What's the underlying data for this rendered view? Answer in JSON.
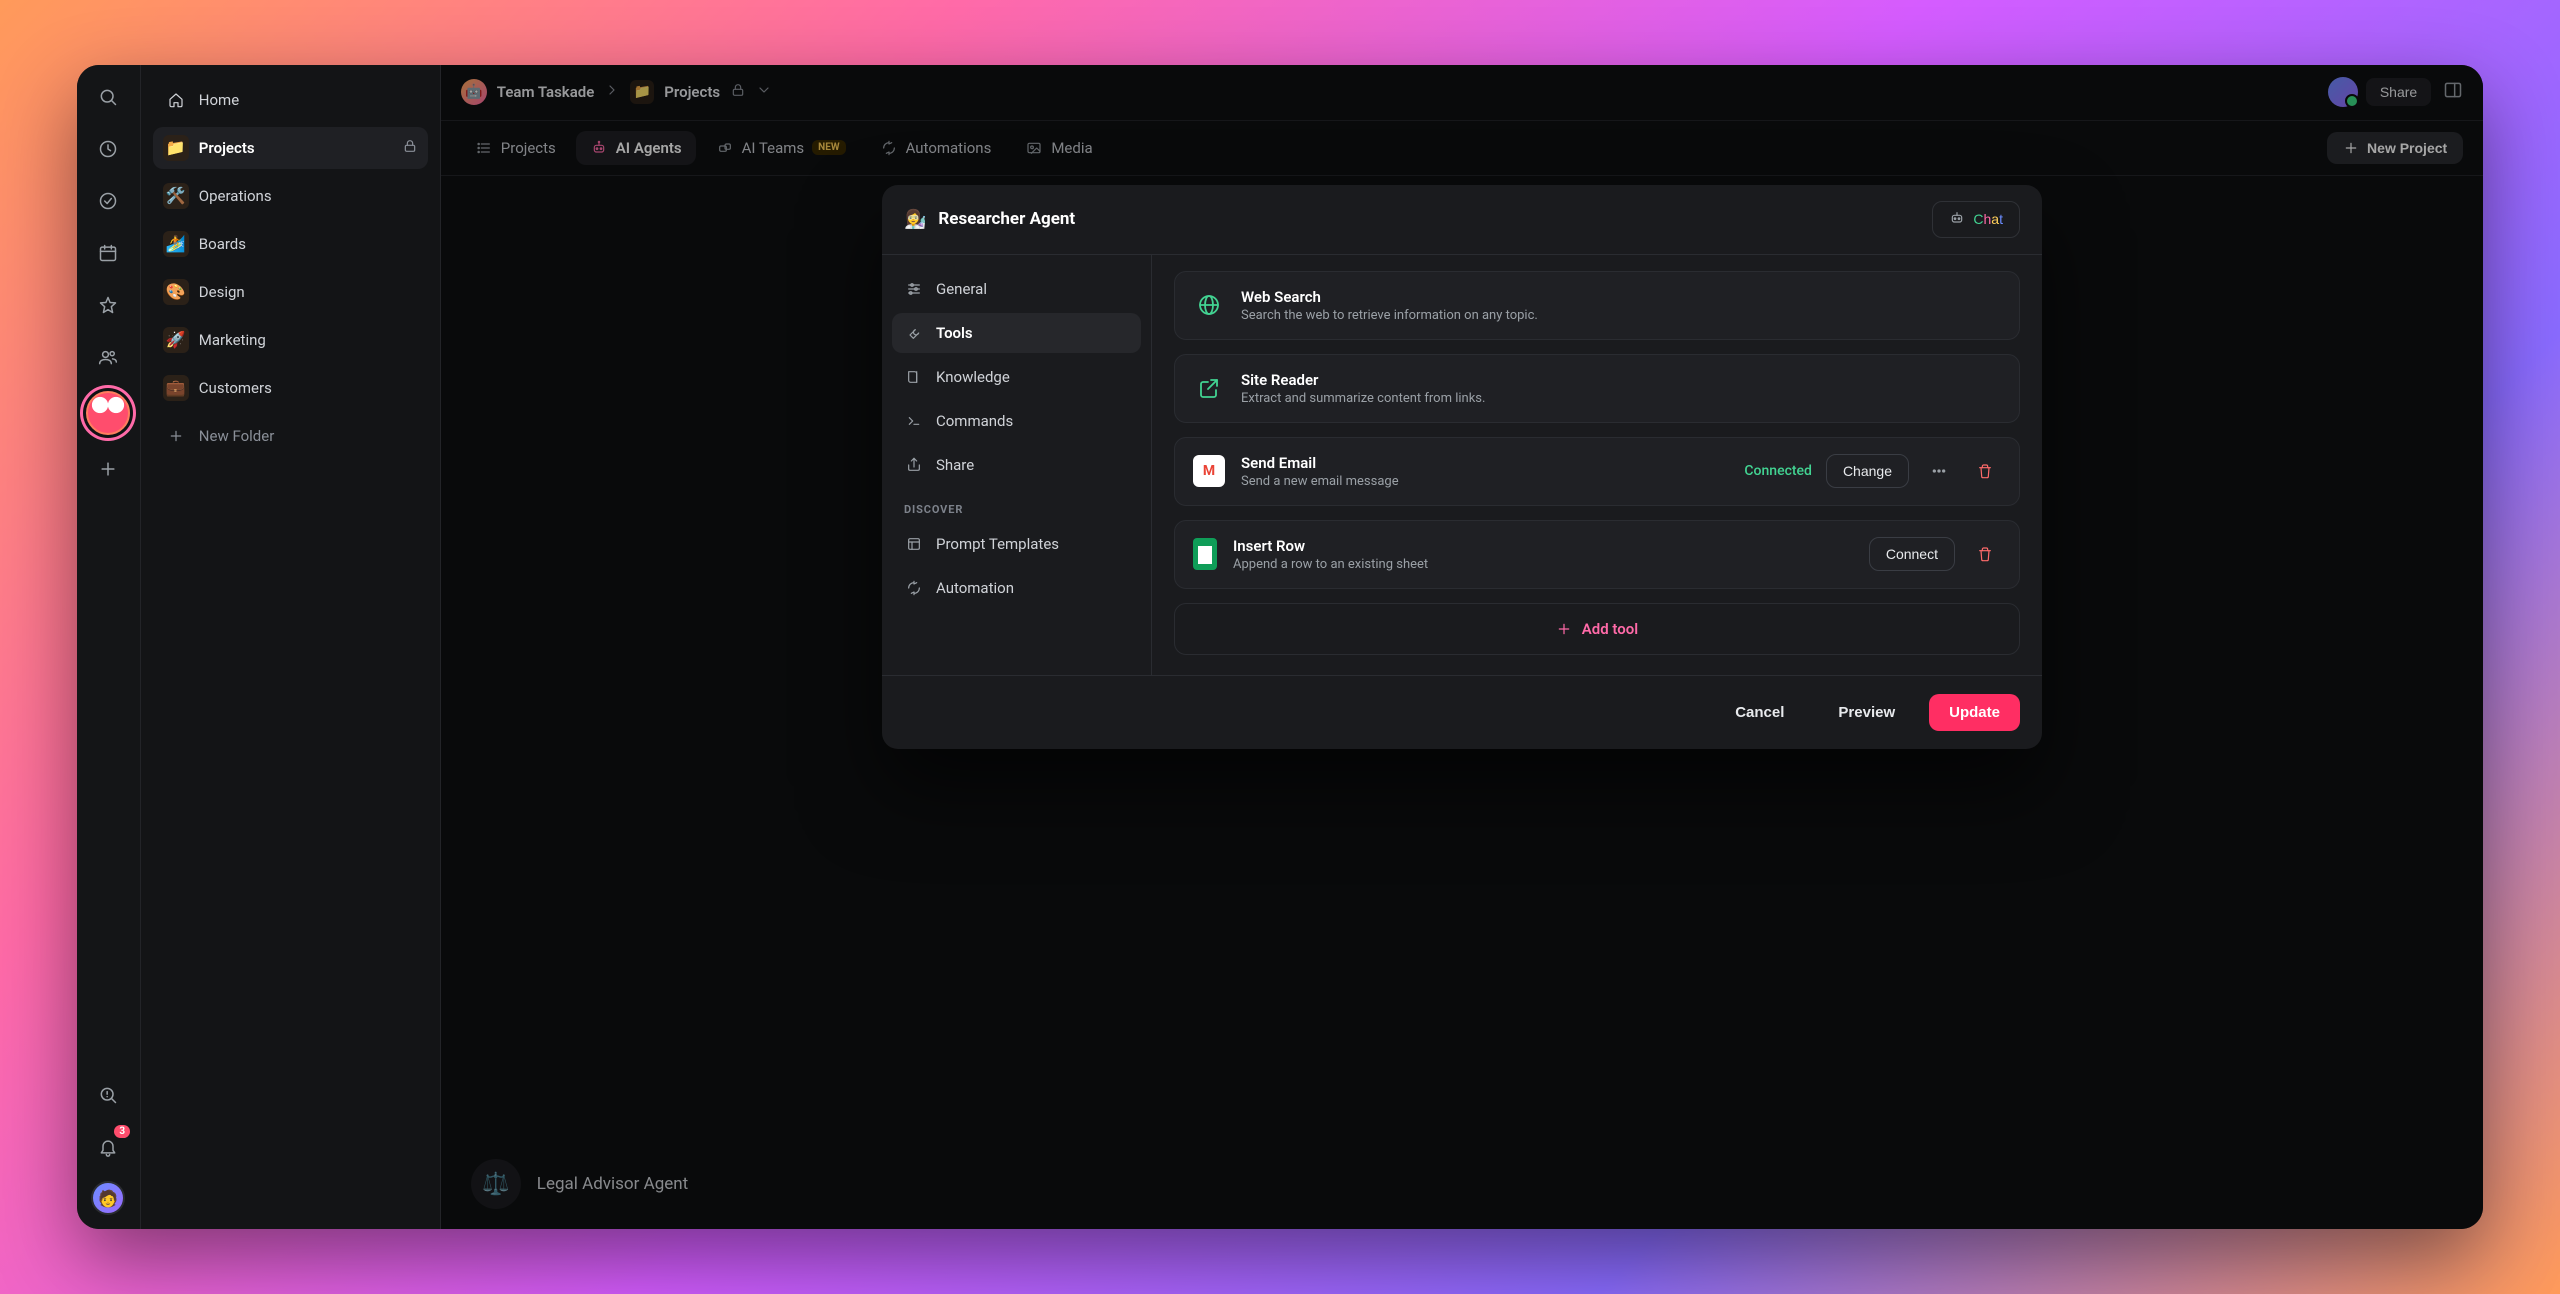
{
  "rail": {
    "notification_count": "3"
  },
  "sidebar": {
    "home_label": "Home",
    "items": [
      {
        "emoji": "📁",
        "label": "Projects",
        "locked": true,
        "active": true
      },
      {
        "emoji": "🛠️",
        "label": "Operations",
        "locked": false
      },
      {
        "emoji": "🏄",
        "label": "Boards",
        "locked": false
      },
      {
        "emoji": "🎨",
        "label": "Design",
        "locked": false
      },
      {
        "emoji": "🚀",
        "label": "Marketing",
        "locked": false
      },
      {
        "emoji": "💼",
        "label": "Customers",
        "locked": false
      }
    ],
    "new_label": "New Folder"
  },
  "breadcrumb": {
    "team": "Team Taskade",
    "folder": "Projects",
    "locked": true
  },
  "topbar": {
    "share_label": "Share"
  },
  "tabs": {
    "projects": "Projects",
    "ai_agents": "AI Agents",
    "ai_teams": "AI Teams",
    "ai_teams_badge": "NEW",
    "automations": "Automations",
    "media": "Media",
    "new_project": "New Project"
  },
  "background_agent": {
    "name": "Legal Advisor Agent"
  },
  "modal": {
    "agent_emoji": "👩‍🔬",
    "agent_title": "Researcher Agent",
    "chat_label": "Chat",
    "sidebar": {
      "items": [
        {
          "key": "general",
          "label": "General"
        },
        {
          "key": "tools",
          "label": "Tools"
        },
        {
          "key": "knowledge",
          "label": "Knowledge"
        },
        {
          "key": "commands",
          "label": "Commands"
        },
        {
          "key": "share",
          "label": "Share"
        }
      ],
      "discover_label": "DISCOVER",
      "discover_items": [
        {
          "key": "prompt_templates",
          "label": "Prompt Templates"
        },
        {
          "key": "automation",
          "label": "Automation"
        }
      ]
    },
    "tools": [
      {
        "id": "web_search",
        "title": "Web Search",
        "desc": "Search the web to retrieve information on any topic.",
        "icon": "globe"
      },
      {
        "id": "site_reader",
        "title": "Site Reader",
        "desc": "Extract and summarize content from links.",
        "icon": "external"
      },
      {
        "id": "send_email",
        "title": "Send Email",
        "desc": "Send a new email message",
        "icon": "gmail",
        "status": "Connected",
        "change_label": "Change"
      },
      {
        "id": "insert_row",
        "title": "Insert Row",
        "desc": "Append a row to an existing sheet",
        "icon": "sheets",
        "connect_label": "Connect"
      }
    ],
    "add_tool_label": "Add tool",
    "footer": {
      "cancel": "Cancel",
      "preview": "Preview",
      "update": "Update"
    }
  }
}
